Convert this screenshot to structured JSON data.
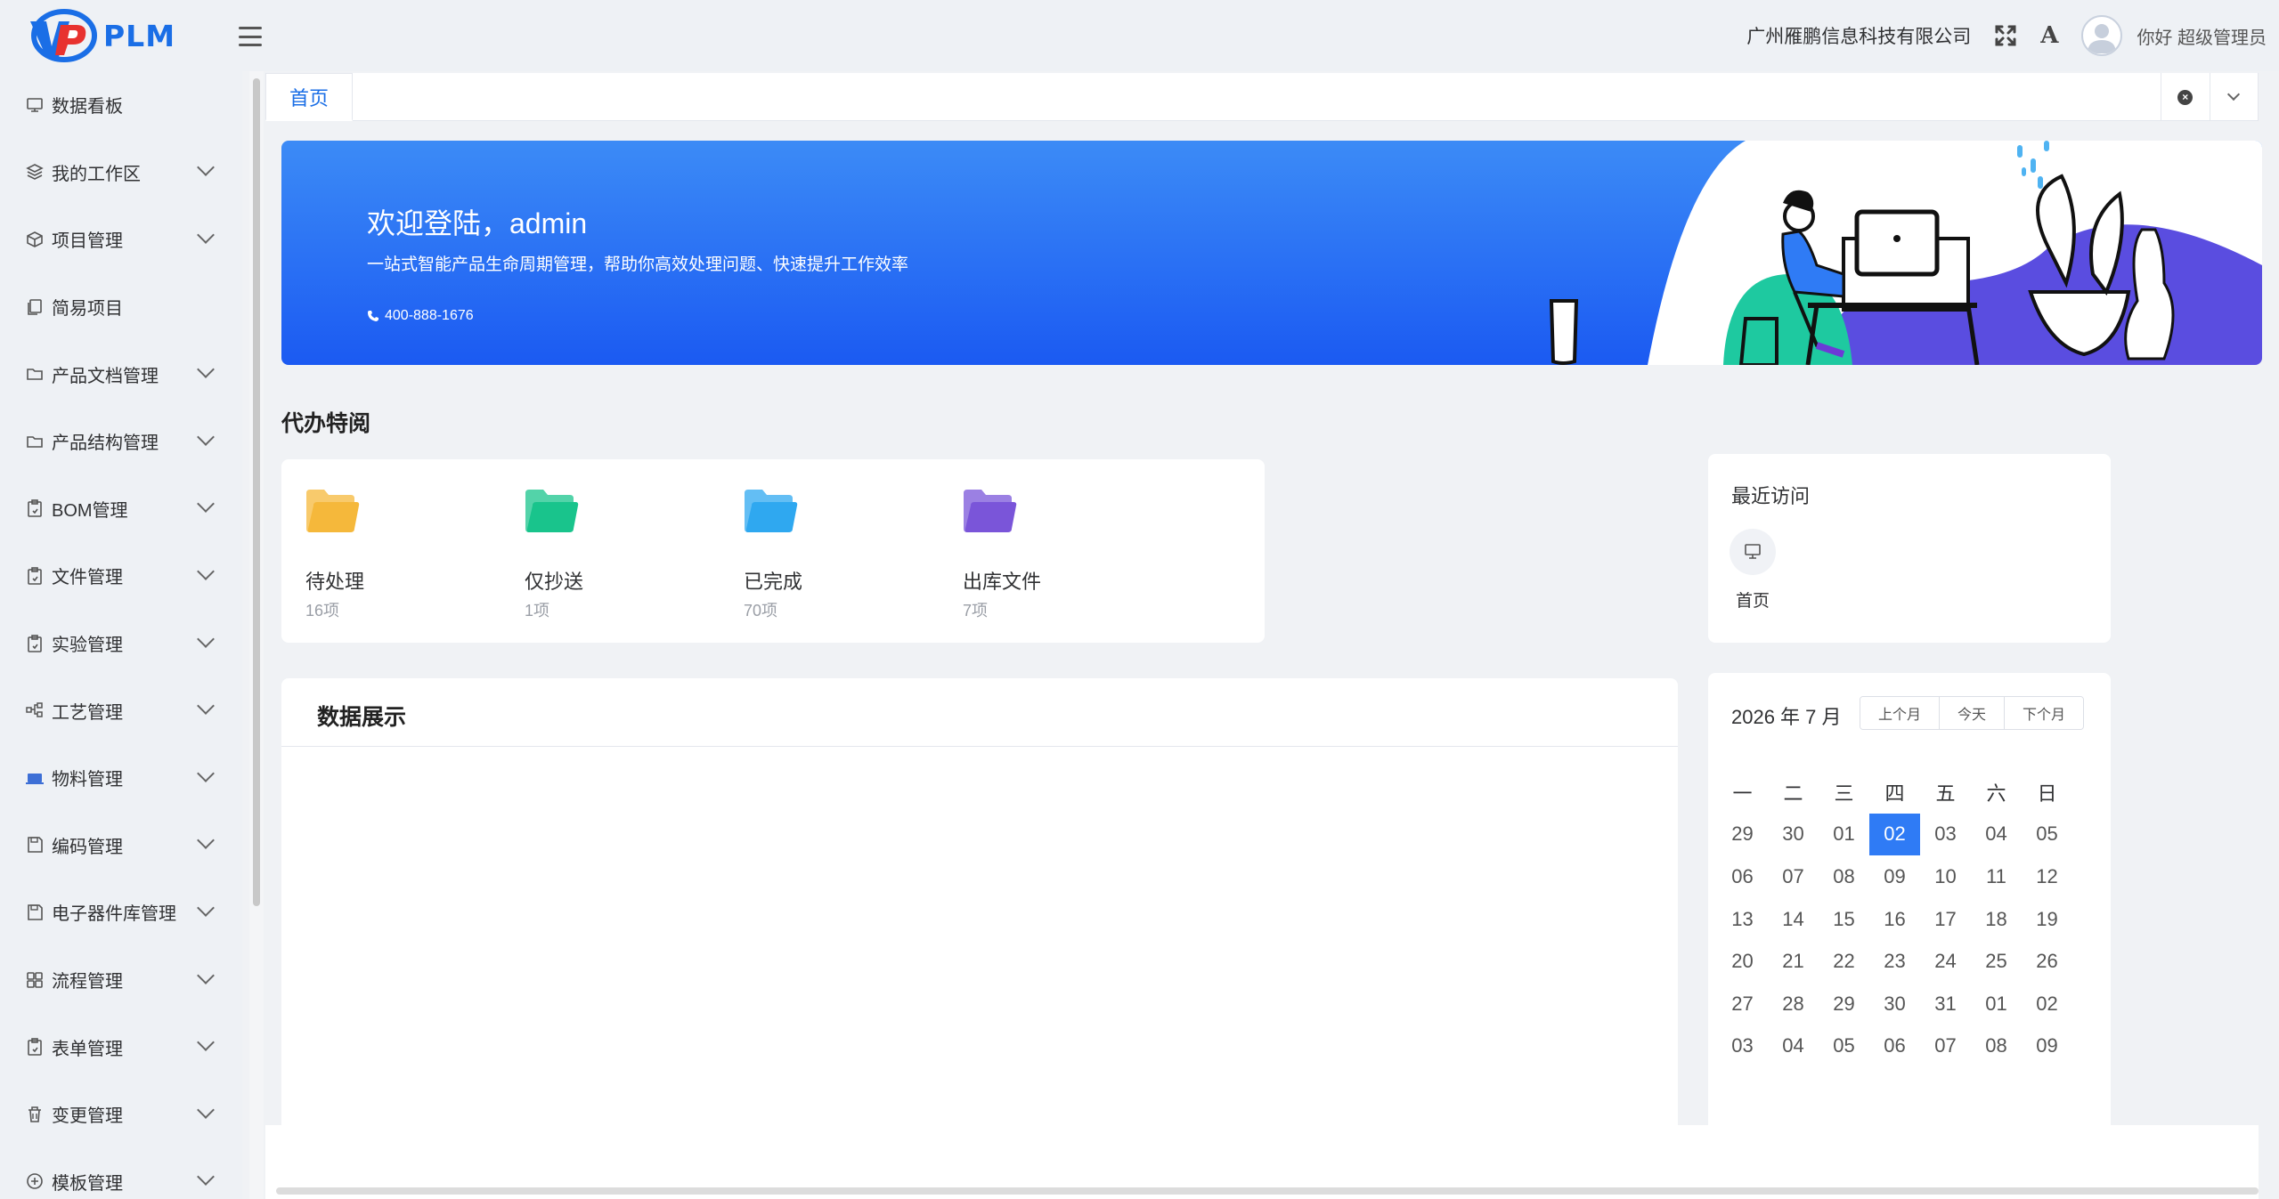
{
  "header": {
    "logo_text": "PLM",
    "company": "广州雁鹏信息科技有限公司",
    "font_icon_label": "A",
    "greeting": "你好 超级管理员"
  },
  "sidebar": {
    "items": [
      {
        "label": "数据看板",
        "icon": "monitor-icon",
        "expandable": false
      },
      {
        "label": "我的工作区",
        "icon": "layers-icon",
        "expandable": true
      },
      {
        "label": "项目管理",
        "icon": "cube-icon",
        "expandable": true
      },
      {
        "label": "简易项目",
        "icon": "copy-icon",
        "expandable": false
      },
      {
        "label": "产品文档管理",
        "icon": "folder-icon",
        "expandable": true
      },
      {
        "label": "产品结构管理",
        "icon": "folder-icon",
        "expandable": true
      },
      {
        "label": "BOM管理",
        "icon": "clipboard-icon",
        "expandable": true
      },
      {
        "label": "文件管理",
        "icon": "clipboard-icon",
        "expandable": true
      },
      {
        "label": "实验管理",
        "icon": "clipboard-icon",
        "expandable": true
      },
      {
        "label": "工艺管理",
        "icon": "tree-icon",
        "expandable": true
      },
      {
        "label": "物料管理",
        "icon": "laptop-icon",
        "expandable": true
      },
      {
        "label": "编码管理",
        "icon": "save-icon",
        "expandable": true
      },
      {
        "label": "电子器件库管理",
        "icon": "save-icon",
        "expandable": true
      },
      {
        "label": "流程管理",
        "icon": "grid-icon",
        "expandable": true
      },
      {
        "label": "表单管理",
        "icon": "clipboard-icon",
        "expandable": true
      },
      {
        "label": "变更管理",
        "icon": "trash-icon",
        "expandable": true
      },
      {
        "label": "模板管理",
        "icon": "plus-circle-icon",
        "expandable": true
      }
    ]
  },
  "tabs": {
    "home": "首页"
  },
  "banner": {
    "title": "欢迎登陆，admin",
    "subtitle": "一站式智能产品生命周期管理，帮助你高效处理问题、快速提升工作效率",
    "phone": "400-888-1676"
  },
  "todo": {
    "title": "代办特阅",
    "cards": [
      {
        "label": "待处理",
        "count": "16项",
        "color": "#f5b83b"
      },
      {
        "label": "仅抄送",
        "count": "1项",
        "color": "#19c48c"
      },
      {
        "label": "已完成",
        "count": "70项",
        "color": "#2fa8f0"
      },
      {
        "label": "出库文件",
        "count": "7项",
        "color": "#7a55d9"
      }
    ]
  },
  "recent": {
    "title": "最近访问",
    "items": [
      {
        "label": "首页",
        "icon": "monitor-icon"
      }
    ]
  },
  "data_panel": {
    "title": "数据展示"
  },
  "calendar": {
    "title": "2026 年 7 月",
    "prev": "上个月",
    "today": "今天",
    "next": "下个月",
    "weekdays": [
      "一",
      "二",
      "三",
      "四",
      "五",
      "六",
      "日"
    ],
    "weeks": [
      [
        "29",
        "30",
        "01",
        "02",
        "03",
        "04",
        "05"
      ],
      [
        "06",
        "07",
        "08",
        "09",
        "10",
        "11",
        "12"
      ],
      [
        "13",
        "14",
        "15",
        "16",
        "17",
        "18",
        "19"
      ],
      [
        "20",
        "21",
        "22",
        "23",
        "24",
        "25",
        "26"
      ],
      [
        "27",
        "28",
        "29",
        "30",
        "31",
        "01",
        "02"
      ],
      [
        "03",
        "04",
        "05",
        "06",
        "07",
        "08",
        "09"
      ]
    ],
    "selected_day": "02",
    "accent": "#2f7bf5"
  }
}
